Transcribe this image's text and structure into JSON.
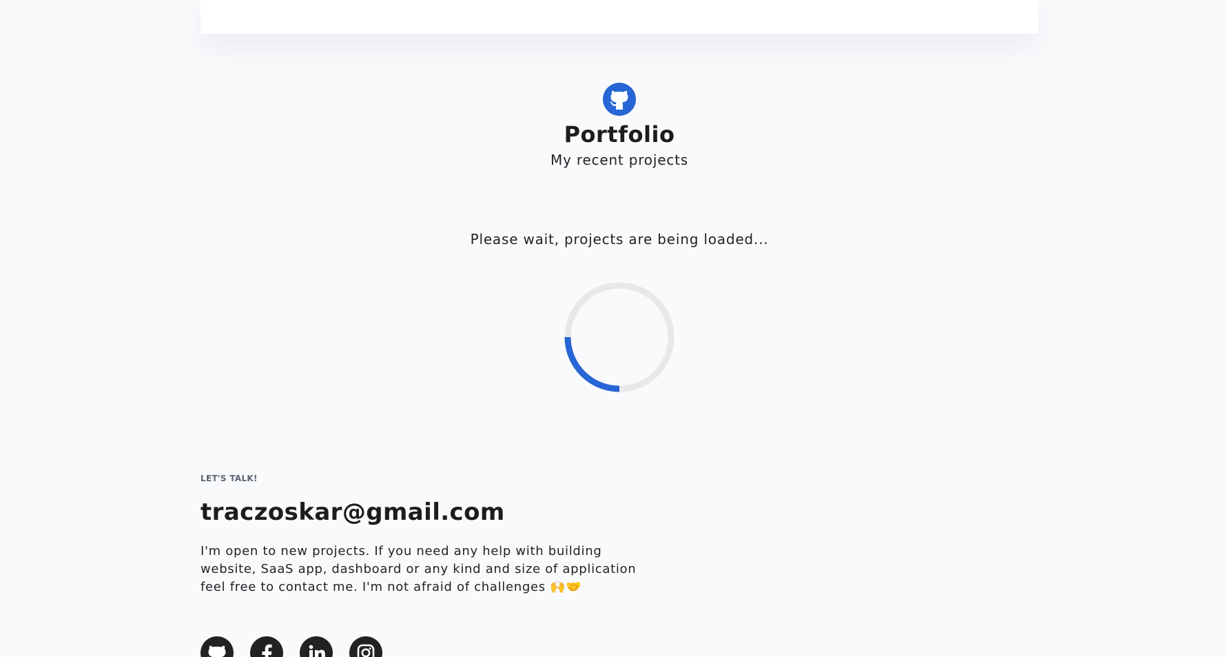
{
  "header": {
    "title": "Portfolio",
    "subtitle": "My recent projects",
    "icon": "github-icon",
    "accent_color": "#2766d4"
  },
  "projects": {
    "loading_text": "Please wait, projects are being loaded...",
    "spinner_progress": 0.25
  },
  "contact": {
    "eyebrow": "LET'S TALK!",
    "email": "traczoskar@gmail.com",
    "blurb": "I'm open to new projects. If you need any help with building website, SaaS app, dashboard or any kind and size of application feel free to contact me. I'm not afraid of challenges 🙌🤝"
  },
  "socials": [
    "github-icon",
    "facebook-icon",
    "linkedin-icon",
    "instagram-icon"
  ]
}
